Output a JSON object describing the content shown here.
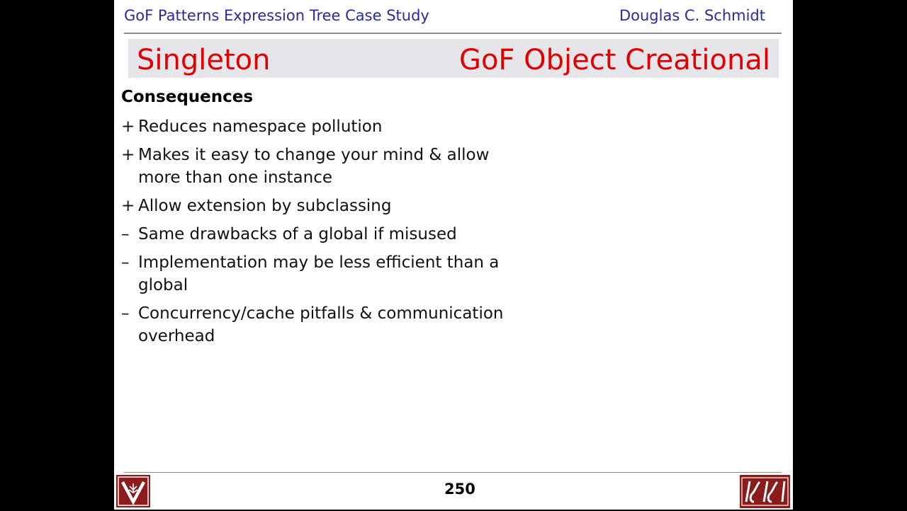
{
  "header": {
    "course_title": "GoF Patterns Expression Tree Case Study",
    "author": "Douglas C. Schmidt"
  },
  "title": {
    "pattern": "Singleton",
    "category": "GoF Object Creational"
  },
  "content": {
    "heading": "Consequences",
    "bullets": [
      {
        "mark": "+",
        "text": "Reduces namespace pollution"
      },
      {
        "mark": "+",
        "text": "Makes it easy to change your mind & allow more than one instance"
      },
      {
        "mark": "+",
        "text": "Allow extension by subclassing"
      },
      {
        "mark": "–",
        "text": "Same drawbacks of a global if misused"
      },
      {
        "mark": "–",
        "text": "Implementation may be less efficient than a global"
      },
      {
        "mark": "–",
        "text": "Concurrency/cache pitfalls & communication overhead"
      }
    ]
  },
  "footer": {
    "page_number": "250",
    "left_logo": "vanderbilt-logo",
    "right_logo": "isis-logo"
  },
  "colors": {
    "header_text": "#2a2aa0",
    "title_text": "#e00000",
    "title_bar": "#e6e6ea",
    "logo_bg": "#8c1b1b"
  }
}
